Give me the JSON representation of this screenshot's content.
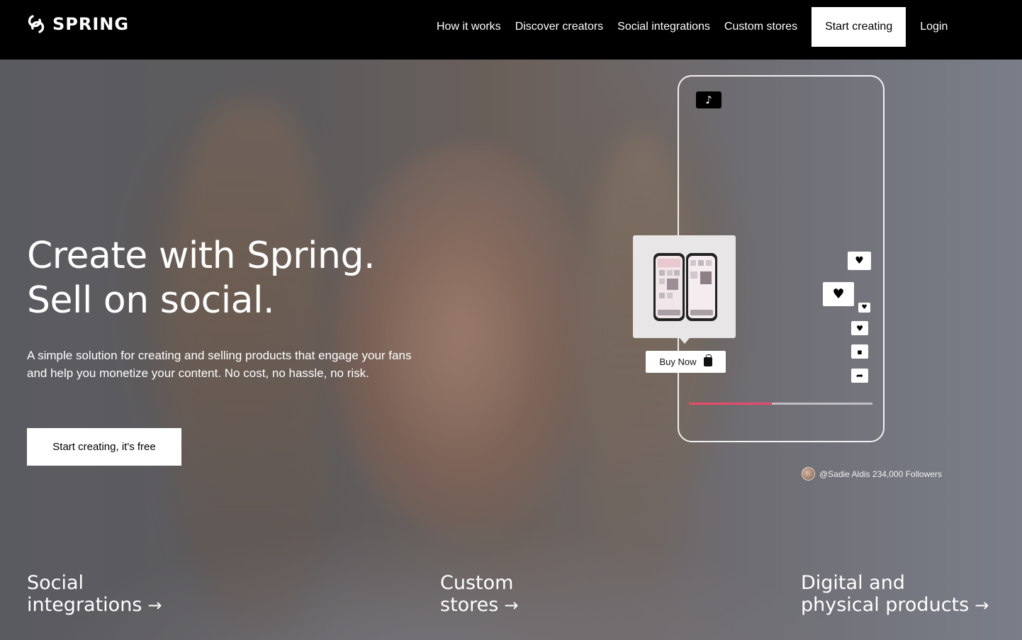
{
  "nav": {
    "logo_text": "SPRING",
    "links": [
      "How it works",
      "Discover creators",
      "Social integrations",
      "Custom stores"
    ],
    "cta": "Start creating",
    "login": "Login"
  },
  "hero": {
    "headline_line1": "Create with Spring.",
    "headline_line2": "Sell on social.",
    "subtext": "A simple solution for creating and selling products that engage your fans and help you monetize your content. No cost, no hassle, no risk.",
    "cta": "Start creating, it's free"
  },
  "phone": {
    "platform_icon": "tiktok-icon",
    "buy_now": "Buy Now",
    "creator": "@Sadie Aldis 234,000 Followers",
    "progress_fraction": 0.45,
    "icons": [
      "heart-icon",
      "heart-icon",
      "heart-icon",
      "heart-icon",
      "comment-icon",
      "share-icon"
    ]
  },
  "bottom": {
    "social_line1": "Social",
    "social_line2": "integrations",
    "stores_line1": "Custom",
    "stores_line2": "stores",
    "products_line1": "Digital and",
    "products_line2": "physical products",
    "arrow": "→"
  },
  "colors": {
    "nav_bg": "#000000",
    "accent_progress": "#e84a6a",
    "text": "#ffffff"
  }
}
